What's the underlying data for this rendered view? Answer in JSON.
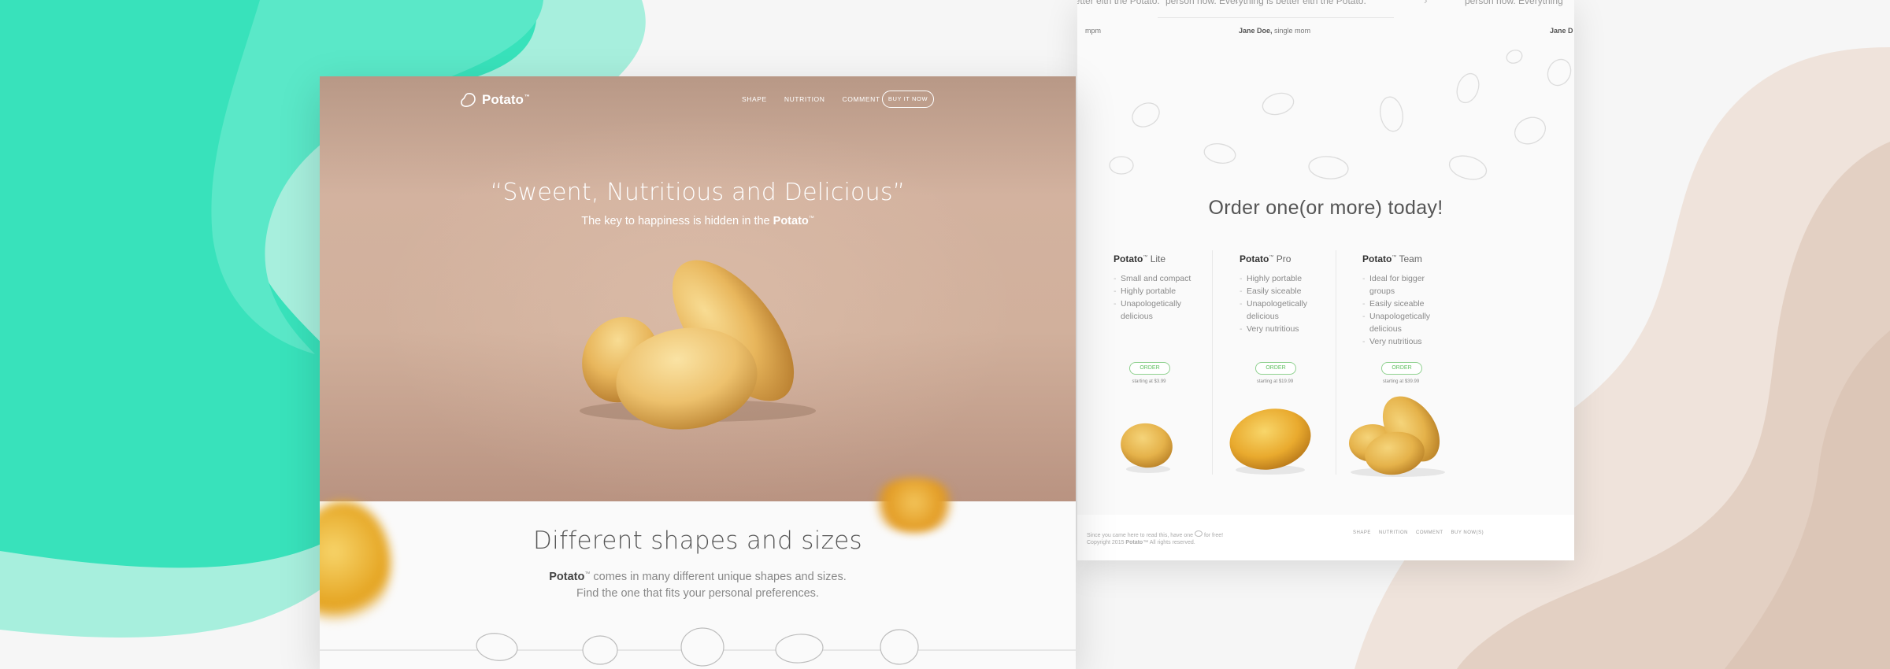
{
  "hero": {
    "logo_name": "Potato",
    "logo_tm": "™",
    "nav": [
      "SHAPE",
      "NUTRITION",
      "COMMENT"
    ],
    "buy_button": "BUY IT NOW",
    "headline": "“Sweent, Nutritious and Delicious”",
    "subtitle_prefix": "The key to happiness is hidden in the ",
    "subtitle_brand": "Potato",
    "subtitle_tm": "™"
  },
  "section": {
    "title": "Different shapes and sizes",
    "brand": "Potato",
    "tm": "™",
    "line1": " comes in many different unique shapes and sizes.",
    "line2": "Find the one that fits your personal preferences."
  },
  "testimonials": {
    "quotes": [
      "better eith the Potato.",
      "person now. Everything is better eith the Potato.",
      "person now. Everything"
    ],
    "authors": [
      "mpm",
      "Jane Doe,",
      "Jane D"
    ],
    "author_role": "single mom"
  },
  "order": {
    "title": "Order one(or more) today!",
    "plans": [
      {
        "brand": "Potato",
        "tm": "™",
        "tier": "Lite",
        "features": [
          "Small and compact",
          "Highly portable",
          "Unapologetically delicious"
        ],
        "button": "ORDER",
        "price": "starting at $3.99"
      },
      {
        "brand": "Potato",
        "tm": "™",
        "tier": "Pro",
        "features": [
          "Highly portable",
          "Easily siceable",
          "Unapologetically delicious",
          "Very nutritious"
        ],
        "button": "ORDER",
        "price": "starting at $19.99"
      },
      {
        "brand": "Potato",
        "tm": "™",
        "tier": "Team",
        "features": [
          "Ideal for bigger groups",
          "Easily siceable",
          "Unapologetically delicious",
          "Very nutritious"
        ],
        "button": "ORDER",
        "price": "starting at $39.99"
      }
    ]
  },
  "footer": {
    "line1_a": "Since you came here to read this, have one",
    "line1_b": "for free!",
    "line2_a": "Copyright 2015 ",
    "line2_brand": "Potato",
    "line2_b": "™ All rights reserved.",
    "links": [
      "SHAPE",
      "NUTRITION",
      "COMMENT",
      "BUY NOW(S)"
    ]
  },
  "colors": {
    "teal": "#38e2bb",
    "teal_light": "#a7efdd",
    "tan": "#e8d8cd",
    "hero_brown": "#c9a693",
    "order_green": "#5fbf5f"
  },
  "icons": [
    "potato-logo-icon",
    "potato-outline-icon",
    "chevron-left-icon",
    "chevron-right-icon"
  ]
}
